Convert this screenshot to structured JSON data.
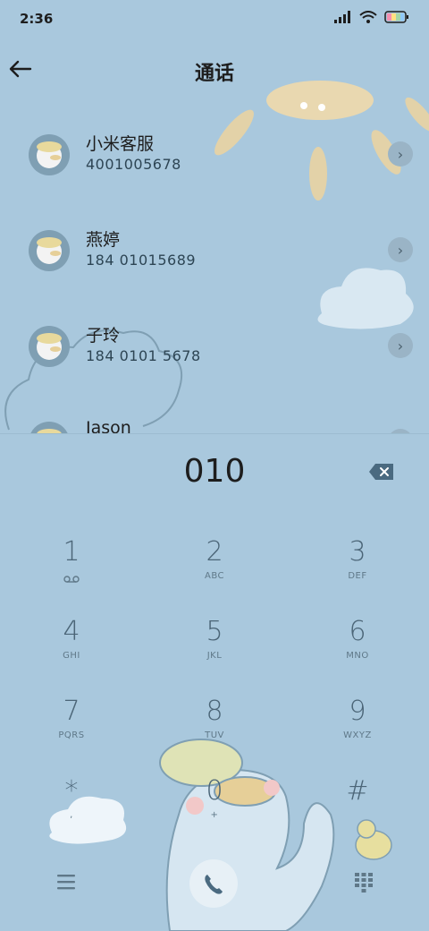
{
  "status": {
    "time": "2:36"
  },
  "header": {
    "title": "通话"
  },
  "contacts": [
    {
      "name": "小米客服",
      "number": "4001005678"
    },
    {
      "name": "燕婷",
      "number": "184 01015689"
    },
    {
      "name": "子玲",
      "number": "184 0101 5678"
    },
    {
      "name": "Jason",
      "number": ""
    }
  ],
  "dialer": {
    "entered": "010",
    "keys": [
      {
        "num": "1",
        "sub": ""
      },
      {
        "num": "2",
        "sub": "ABC"
      },
      {
        "num": "3",
        "sub": "DEF"
      },
      {
        "num": "4",
        "sub": "GHI"
      },
      {
        "num": "5",
        "sub": "JKL"
      },
      {
        "num": "6",
        "sub": "MNO"
      },
      {
        "num": "7",
        "sub": "PQRS"
      },
      {
        "num": "8",
        "sub": "TUV"
      },
      {
        "num": "9",
        "sub": "WXYZ"
      },
      {
        "num": "*",
        "sub": ","
      },
      {
        "num": "0",
        "sub": "+"
      },
      {
        "num": "#",
        "sub": ""
      }
    ]
  },
  "colors": {
    "background": "#a9c8dd",
    "key_text": "#4b6577",
    "accent": "#4a6a80"
  }
}
